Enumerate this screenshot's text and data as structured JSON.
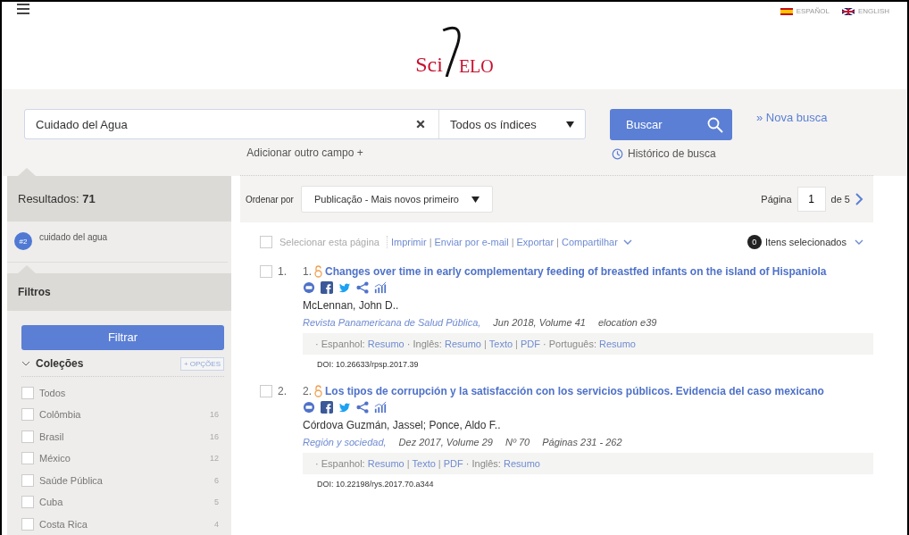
{
  "languages": [
    {
      "label": "ESPAÑOL",
      "kind": "spain"
    },
    {
      "label": "ENGLISH",
      "kind": "uk"
    }
  ],
  "logo": {
    "first": "Sci",
    "second": "ELO"
  },
  "search": {
    "value": "Cuidado del Agua",
    "index": "Todos os índices",
    "button": "Buscar",
    "new_search": "» Nova busca",
    "add_field": "Adicionar outro campo +",
    "history": "Histórico de busca"
  },
  "sidebar": {
    "results_label": "Resultados:",
    "results_count": "71",
    "query": {
      "badge": "#2",
      "text": "cuidado del agua"
    },
    "filters_title": "Filtros",
    "filter_button": "Filtrar",
    "collections": {
      "title": "Coleções",
      "expanded": true,
      "options_button": "+ OPÇÕES",
      "items": [
        {
          "label": "Todos",
          "checked": false
        },
        {
          "label": "Colômbia",
          "count": "16",
          "checked": false
        },
        {
          "label": "Brasil",
          "count": "16",
          "checked": false
        },
        {
          "label": "México",
          "count": "12",
          "checked": false
        },
        {
          "label": "Saúde Pública",
          "count": "6",
          "checked": false
        },
        {
          "label": "Cuba",
          "count": "5",
          "checked": false
        },
        {
          "label": "Costa Rica",
          "count": "4",
          "checked": false
        }
      ]
    }
  },
  "sort": {
    "label": "Ordenar por",
    "value": "Publicação - Mais novos primeiro",
    "page_label": "Página",
    "page": "1",
    "page_total": "de 5"
  },
  "toolbar": {
    "select_page": {
      "label": "Selecionar esta página",
      "checked": false
    },
    "separator": "|",
    "actions": [
      "Imprimir",
      "Enviar por e-mail",
      "Exportar",
      "Compartilhar"
    ],
    "selected_count": "0",
    "selected_label": "Itens selecionados"
  },
  "results": [
    {
      "index": "1.",
      "number": "1.",
      "checked": false,
      "title": "Changes over time in early complementary feeding of breastfed infants on the island of Hispaniola",
      "authors": "McLennan, John D..",
      "journal": "Revista Panamericana de Salud Pública,",
      "details": [
        "Jun 2018, Volume 41",
        "elocation e39"
      ],
      "languages": [
        {
          "name": "· Espanhol:",
          "links": [
            "Resumo"
          ]
        },
        {
          "name": "· Inglês:",
          "links": [
            "Resumo",
            "Texto",
            "PDF"
          ]
        },
        {
          "name": "· Português:",
          "links": [
            "Resumo"
          ]
        }
      ],
      "doi": "DOI: 10.26633/rpsp.2017.39"
    },
    {
      "index": "2.",
      "number": "2.",
      "checked": false,
      "title": "Los tipos de corrupción y la satisfacción con los servicios públicos. Evidencia del caso mexicano",
      "authors": "Córdova Guzmán, Jassel; Ponce, Aldo F..",
      "journal": "Región y sociedad,",
      "details": [
        "Dez 2017, Volume 29",
        "Nº 70",
        "Páginas 231 - 262"
      ],
      "languages": [
        {
          "name": "· Espanhol:",
          "links": [
            "Resumo",
            "Texto",
            "PDF"
          ]
        },
        {
          "name": "· Inglês:",
          "links": [
            "Resumo"
          ]
        }
      ],
      "doi": "DOI: 10.22198/rys.2017.70.a344"
    }
  ]
}
